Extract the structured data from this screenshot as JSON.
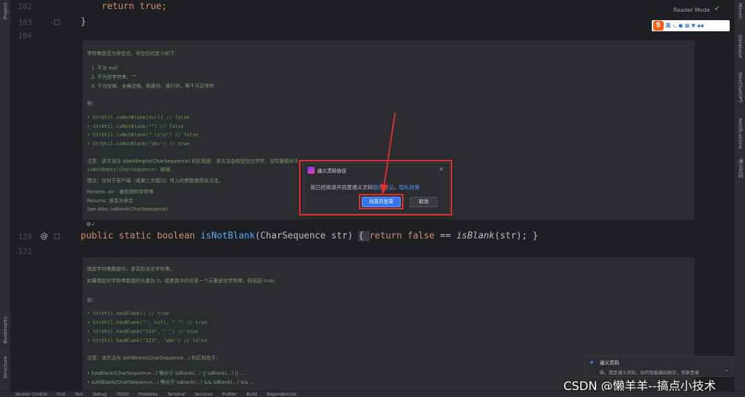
{
  "left_strip": {
    "top_label": "Project",
    "bookmarks_label": "Bookmarks",
    "structure_label": "Structure"
  },
  "right_strip": {
    "maven_label": "Maven",
    "database_label": "Database",
    "newchatgpt_label": "NexChatGPT",
    "notifications_label": "Notifications",
    "tongyi_label": "通义灵码"
  },
  "editor": {
    "line_102": "102",
    "line_103": "103",
    "line_104": "104",
    "line_129": "129",
    "line_132": "132",
    "code_102": "return true;",
    "code_103": "}",
    "code_129_kw1": "public static boolean ",
    "code_129_fn": "isNotBlank",
    "code_129_params": "(CharSequence str) ",
    "code_129_body_kw": "return false",
    "code_129_body_rest": " == ",
    "code_129_call": "isBlank",
    "code_129_end": "(str); }",
    "code_129_open": "{ ",
    "annotation": "@",
    "ai_sparkle": "⚙✓"
  },
  "doc1": {
    "l1": "字符串是否为非空白，非空白的定义如下：",
    "l2": "1. 不为 null",
    "l3": "2. 不为空字符串：\"\"",
    "l4": "3. 不为空格、全角空格、制表符、换行符，等不可见字符",
    "l5": "例：",
    "l6": "• StrUtil.isNotBlank(null) // false",
    "l7": "• StrUtil.isNotBlank(\"\") // false",
    "l8": "• StrUtil.isNotBlank(\" \\t\\n\") // false",
    "l9": "• StrUtil.isNotBlank(\"abc\") // true",
    "l10": "注意：该方法与 isNotEmpty(CharSequence) 的区别是：该方法会校验空白字符，且性能相对于",
    "l11": "isNotEmpty(CharSequence) 略慢。",
    "l12": "建议：仅对于客户端（或第三方接口）传入的参数使用该方法。",
    "l13": "Params:  str - 被检测的字符串",
    "l14": "Returns:  是否为非空",
    "l15": "See Also: isBlank(CharSequence)"
  },
  "doc2": {
    "l1": "指定字符串数组中，是否包含空字符串。",
    "l2": "如果指定的字符串数组的长度为 0，或者其中的任意一个元素是空字符串，则返回 true。",
    "l3": "例：",
    "l4": "• StrUtil.hasBlank() // true",
    "l5": "• StrUtil.hasBlank(\"\", null, \" \") // true",
    "l6": "• StrUtil.hasBlank(\"123\", \" \") // true",
    "l7": "• StrUtil.hasBlank(\"123\", \"abc\") // false",
    "l8": "注意：该方法与 isAllBlank(CharSequence...) 的区别在于：",
    "l9": "• hasBlank(CharSequence...) 等价于 isBlank(...) || isBlank(...) || ...",
    "l10": "• isAllBlank(CharSequence...) 等价于 isBlank(...) && isBlank(...) && ..."
  },
  "reader_mode": "Reader Mode",
  "ime": {
    "logo": "S",
    "lang": "英"
  },
  "dialog": {
    "title": "通义灵码协议",
    "close": "×",
    "msg_prefix": "我已经阅读并同意通义灵码",
    "link_service": "服务协议",
    "sep": "，",
    "link_privacy": "隐私政策",
    "agree_label": "同意并登录",
    "cancel_label": "取消"
  },
  "notification": {
    "title": "通义灵码",
    "body": "嗨，我是通义灵码，你的智能编码助手，快来登录",
    "chevron": "⌄"
  },
  "watermark": "CSDN @懒羊羊--搞点小技术",
  "statusbar": [
    "Version Control",
    "Find",
    "Run",
    "Debug",
    "TODO",
    "Problems",
    "Terminal",
    "Services",
    "Profiler",
    "Build",
    "Dependencies"
  ],
  "colors": {
    "accent": "#3574f0",
    "highlight": "#e03030",
    "background": "#1e1f22"
  }
}
